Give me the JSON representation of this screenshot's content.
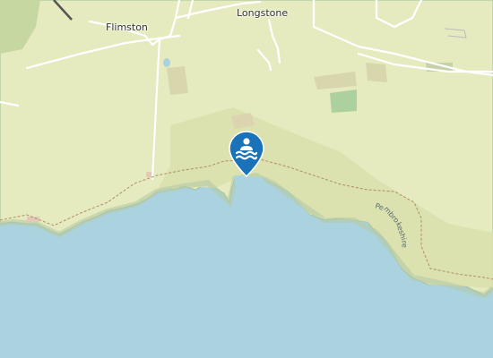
{
  "map": {
    "places": [
      {
        "name": "Flimston"
      },
      {
        "name": "Longstone"
      }
    ],
    "coast_label": "Pembrokeshire",
    "marker": {
      "icon": "swimming-icon",
      "color": "#1a73b8"
    },
    "colors": {
      "land": "#e8ecc4",
      "sea": "#aad3df",
      "heath": "#d6dfae",
      "path": "#c8ac89"
    }
  }
}
